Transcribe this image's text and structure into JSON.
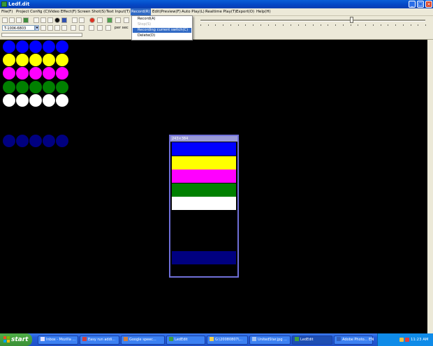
{
  "window": {
    "title": "Ledf.dit"
  },
  "menu": [
    {
      "label": "File(F)",
      "open": false
    },
    {
      "label": "Project Config (C)",
      "open": false
    },
    {
      "label": "Video Effect(F)",
      "open": false
    },
    {
      "label": "Screen Shot(S)",
      "open": false
    },
    {
      "label": "Text Input(T)",
      "open": false
    },
    {
      "label": "Record(R)",
      "open": true
    },
    {
      "label": "Edit(Preview(F)",
      "open": false
    },
    {
      "label": "Auto Play(L)",
      "open": false
    },
    {
      "label": "Realtime Play(T)",
      "open": false
    },
    {
      "label": "Export(O)",
      "open": false
    },
    {
      "label": "Help(H)",
      "open": false
    }
  ],
  "record_menu": {
    "items": [
      {
        "label": "Record(A)",
        "enabled": true,
        "highlighted": false
      },
      {
        "label": "Stop(S)",
        "enabled": false,
        "highlighted": false
      },
      {
        "label": "Recording current switch(C)",
        "enabled": true,
        "highlighted": true
      },
      {
        "label": "Delete(D)",
        "enabled": true,
        "highlighted": false
      }
    ]
  },
  "toolbar": {
    "font_combo_value": "T-100K-6803",
    "per_sec_label": "per sec",
    "speed_slider_value": 0.67,
    "progress_value": 0
  },
  "canvas": {
    "background": "#000000",
    "dot_rows": [
      {
        "color": "#0000ff"
      },
      {
        "color": "#ffff00"
      },
      {
        "color": "#ff00ff"
      },
      {
        "color": "#008000"
      },
      {
        "color": "#ffffff"
      },
      {
        "color": "#000080"
      }
    ],
    "dots_per_row": 5
  },
  "preview": {
    "title": "243×384",
    "bands": [
      {
        "color": "#0000ff"
      },
      {
        "color": "#ffff00"
      },
      {
        "color": "#ff00ff"
      },
      {
        "color": "#008000"
      },
      {
        "color": "#ffffff"
      },
      {
        "color": "#000080"
      }
    ]
  },
  "taskbar": {
    "start_label": "start",
    "tasks": [
      {
        "label": "Inbox - Mozilla ...",
        "active": false,
        "icon_color": "#e0e0ff"
      },
      {
        "label": "Easy run addi...",
        "active": false,
        "icon_color": "#d04040"
      },
      {
        "label": "Google speec...",
        "active": false,
        "icon_color": "#d08040"
      },
      {
        "label": "LedEdit",
        "active": false,
        "icon_color": "#40a040"
      },
      {
        "label": "G:\\20080807\\...",
        "active": false,
        "icon_color": "#f0d050"
      },
      {
        "label": "UnitedStar.jpg ...",
        "active": false,
        "icon_color": "#a0c0f0"
      },
      {
        "label": "LedEdit",
        "active": true,
        "icon_color": "#40a040"
      },
      {
        "label": "Adobe Photo...",
        "active": false,
        "icon_color": "#3060c0"
      }
    ],
    "language": "EN",
    "clock": "11:23 AM"
  }
}
